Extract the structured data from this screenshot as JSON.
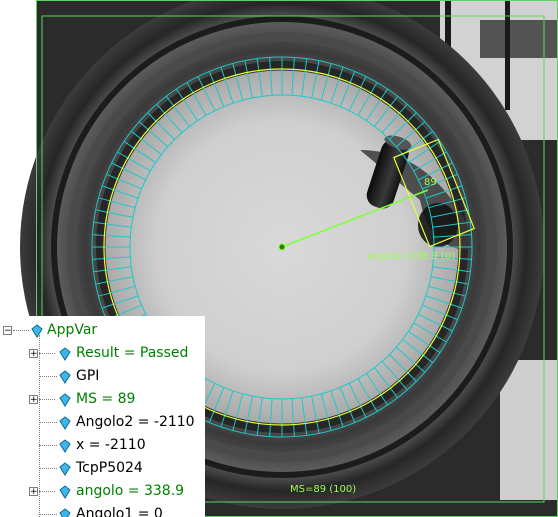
{
  "inspection": {
    "match_score_label": "89",
    "angle_label": "angolo=338.9 (0)",
    "footer_label": "MS=89 (100)",
    "colors": {
      "overlay_green": "#9cff52",
      "tool_yellow": "#e8ff3a",
      "ring_cyan": "#1fc7c7"
    }
  },
  "tree": {
    "root": {
      "label": "AppVar",
      "icon": "gem-icon",
      "expander": "−"
    },
    "items": [
      {
        "label": "Result = Passed",
        "expander": "+",
        "color": "#008000"
      },
      {
        "label": "GPI",
        "expander": "",
        "color": "#000000"
      },
      {
        "label": "MS = 89",
        "expander": "+",
        "color": "#008000"
      },
      {
        "label": "Angolo2 = -2110",
        "expander": "",
        "color": "#000000"
      },
      {
        "label": "x = -2110",
        "expander": "",
        "color": "#000000"
      },
      {
        "label": "TcpP5024",
        "expander": "",
        "color": "#000000"
      },
      {
        "label": "angolo = 338.9",
        "expander": "+",
        "color": "#008000"
      },
      {
        "label": "Angolo1 = 0",
        "expander": "",
        "color": "#000000"
      }
    ]
  }
}
